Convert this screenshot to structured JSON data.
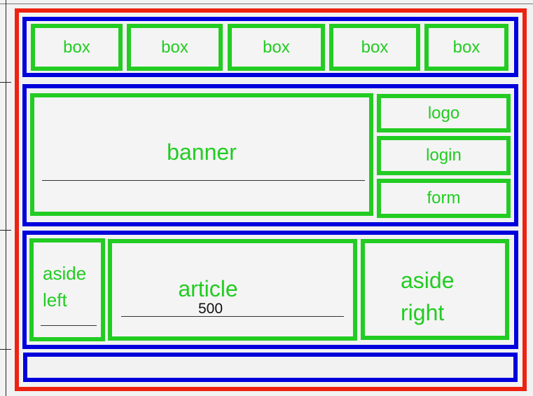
{
  "header": {
    "boxes": [
      "box",
      "box",
      "box",
      "box",
      "box"
    ]
  },
  "main": {
    "banner": "banner",
    "side": [
      "logo",
      "login",
      "form"
    ]
  },
  "content": {
    "aside_left": [
      "aside",
      "left"
    ],
    "article": "article",
    "article_width": "500",
    "aside_right": [
      "aside",
      "right"
    ]
  },
  "colors": {
    "outer": "#ee2211",
    "section": "#0000dd",
    "element": "#22cc22"
  }
}
